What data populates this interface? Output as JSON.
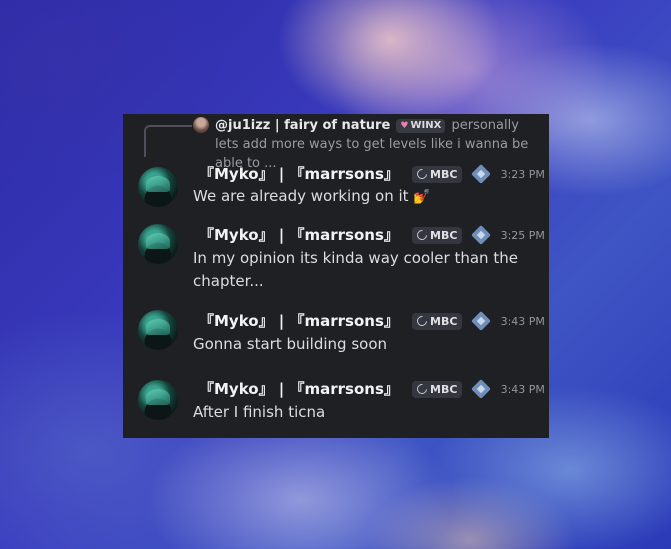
{
  "reply": {
    "username": "@ju1izz | fairy of nature",
    "badge_label": "WINX",
    "text": "personally lets add more ways to get levels like i wanna be able to ..."
  },
  "messages": [
    {
      "username": "『Myko』 | 『marrsons』",
      "tag": "MBC",
      "time": "3:23 PM",
      "text": "We are already working on it",
      "emoji": "💅"
    },
    {
      "username": "『Myko』 | 『marrsons』",
      "tag": "MBC",
      "time": "3:25 PM",
      "text": "In my opinion its kinda way cooler than the chapter..."
    },
    {
      "username": "『Myko』 | 『marrsons』",
      "tag": "MBC",
      "time": "3:43 PM",
      "text": "Gonna start building soon"
    },
    {
      "username": "『Myko』 | 『marrsons』",
      "tag": "MBC",
      "time": "3:43 PM",
      "text": "After I finish ticna"
    }
  ]
}
